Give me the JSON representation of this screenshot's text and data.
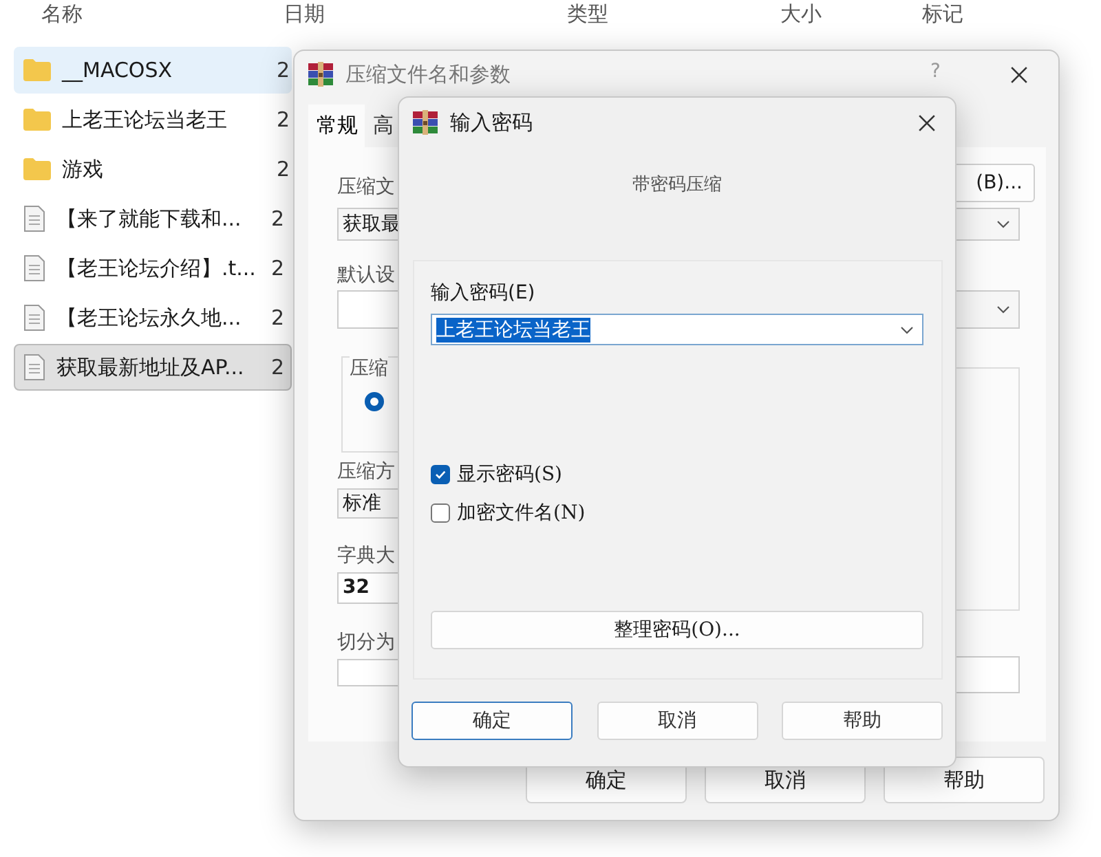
{
  "explorer": {
    "columns": [
      "名称",
      "日期",
      "类型",
      "大小",
      "标记"
    ],
    "rows": [
      {
        "kind": "folder",
        "name": "__MACOSX",
        "date": "2",
        "highlighted": true,
        "selected": false
      },
      {
        "kind": "folder",
        "name": "上老王论坛当老王",
        "date": "2",
        "highlighted": false,
        "selected": false
      },
      {
        "kind": "folder",
        "name": "游戏",
        "date": "2",
        "highlighted": false,
        "selected": false
      },
      {
        "kind": "file",
        "name": "【来了就能下载和...",
        "date": "2",
        "highlighted": false,
        "selected": false
      },
      {
        "kind": "file",
        "name": "【老王论坛介绍】.t...",
        "date": "2",
        "highlighted": false,
        "selected": false
      },
      {
        "kind": "file",
        "name": "【老王论坛永久地...",
        "date": "2",
        "highlighted": false,
        "selected": false
      },
      {
        "kind": "file",
        "name": "获取最新地址及AP...",
        "date": "2",
        "highlighted": false,
        "selected": true
      }
    ]
  },
  "archive_window": {
    "title": "压缩文件名和参数",
    "help": "?",
    "tabs": [
      {
        "label": "常规",
        "selected": true
      },
      {
        "label": "高",
        "selected": false
      }
    ],
    "left_items": [
      {
        "kind": "label",
        "text": "压缩文"
      },
      {
        "kind": "combo",
        "value": "获取最"
      },
      {
        "kind": "label",
        "text": "默认设"
      },
      {
        "kind": "blank"
      },
      {
        "kind": "group",
        "title": "压缩",
        "checked": true
      },
      {
        "kind": "label",
        "text": "压缩方"
      },
      {
        "kind": "combo",
        "value": "标准"
      },
      {
        "kind": "label",
        "text": "字典大"
      },
      {
        "kind": "input",
        "value": "32"
      },
      {
        "kind": "label",
        "text": "切分为"
      },
      {
        "kind": "blank"
      }
    ],
    "right_items": [
      {
        "kind": "button",
        "text": "(B)..."
      },
      {
        "kind": "dropdown"
      },
      {
        "kind": "dropdown"
      },
      {
        "kind": "group"
      },
      {
        "kind": "blank"
      }
    ],
    "buttons": [
      "确定",
      "取消",
      "帮助"
    ]
  },
  "password_dialog": {
    "title": "输入密码",
    "subtitle": "带密码压缩",
    "field_label": "输入密码(E)",
    "password": "上老王论坛当老王",
    "text_selected": true,
    "checkboxes": [
      {
        "label": "显示密码(S)",
        "checked": true
      },
      {
        "label": "加密文件名(N)",
        "checked": false
      }
    ],
    "organize_button": "整理密码(O)...",
    "buttons": [
      {
        "label": "确定",
        "default": true
      },
      {
        "label": "取消",
        "default": false
      },
      {
        "label": "帮助",
        "default": false
      }
    ]
  }
}
